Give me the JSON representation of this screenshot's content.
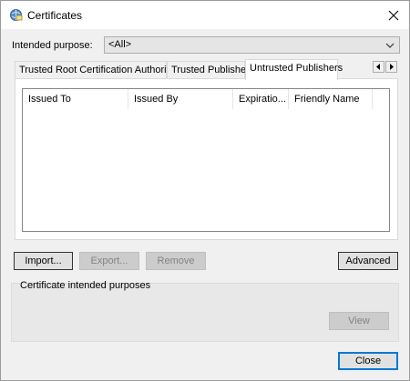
{
  "window": {
    "title": "Certificates"
  },
  "purpose": {
    "label": "Intended purpose:",
    "selected": "<All>"
  },
  "tabs": [
    {
      "label": "Trusted Root Certification Authorities",
      "active": false
    },
    {
      "label": "Trusted Publishers",
      "active": false
    },
    {
      "label": "Untrusted Publishers",
      "active": true
    }
  ],
  "table": {
    "columns": [
      "Issued To",
      "Issued By",
      "Expiratio...",
      "Friendly Name"
    ],
    "rows": []
  },
  "buttons": {
    "import": "Import...",
    "export": "Export...",
    "remove": "Remove",
    "advanced": "Advanced",
    "view": "View",
    "close": "Close"
  },
  "purposes_group": {
    "label": "Certificate intended purposes"
  },
  "icons": {
    "title": "certificate-icon",
    "close": "close-icon",
    "dropdown": "chevron-down-icon",
    "scroll_left": "arrow-left-icon",
    "scroll_right": "arrow-right-icon"
  }
}
